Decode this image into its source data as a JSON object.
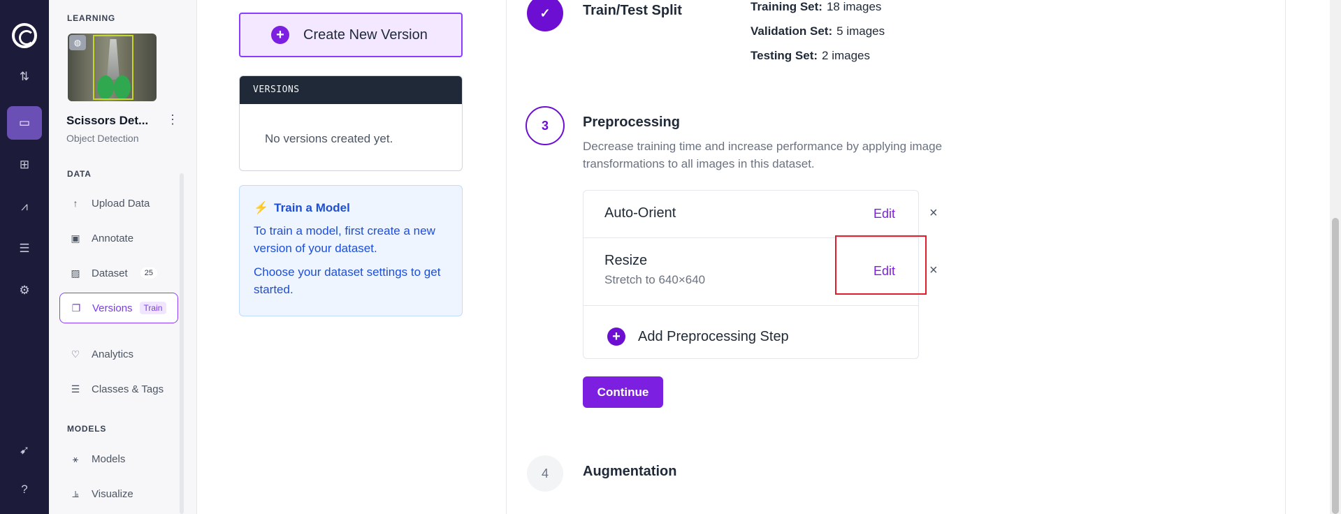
{
  "rail": {
    "icons": [
      "logo-icon",
      "upload-download-icon",
      "inbox-icon",
      "hierarchy-icon",
      "chart-icon",
      "server-icon",
      "settings-icon",
      "rocket-icon",
      "help-icon"
    ]
  },
  "sidebar": {
    "learning_label": "LEARNING",
    "project_name": "Scissors Det...",
    "project_menu": "⋮",
    "project_type": "Object Detection",
    "data_label": "DATA",
    "models_label": "MODELS",
    "items": [
      {
        "label": "Upload Data",
        "icon": "↑"
      },
      {
        "label": "Annotate",
        "icon": "▣"
      },
      {
        "label": "Dataset",
        "icon": "▨",
        "badge": "25"
      },
      {
        "label": "Versions",
        "icon": "❐",
        "badge": "Train"
      },
      {
        "label": "Analytics",
        "icon": "♡"
      },
      {
        "label": "Classes & Tags",
        "icon": "☰"
      },
      {
        "label": "Models",
        "icon": "⚹"
      },
      {
        "label": "Visualize",
        "icon": "⫡"
      }
    ]
  },
  "main": {
    "create_label": "Create New Version",
    "versions_header": "VERSIONS",
    "versions_empty": "No versions created yet.",
    "train_title": "Train a Model",
    "train_p1": "To train a model, first create a new version of your dataset.",
    "train_p2": "Choose your dataset settings to get started."
  },
  "steps": {
    "split": {
      "title": "Train/Test Split",
      "training_label": "Training Set:",
      "training_value": "18 images",
      "validation_label": "Validation Set:",
      "validation_value": "5 images",
      "testing_label": "Testing Set:",
      "testing_value": "2 images"
    },
    "preprocessing": {
      "number": "3",
      "title": "Preprocessing",
      "description": "Decrease training time and increase performance by applying image transformations to all images in this dataset.",
      "items": [
        {
          "name": "Auto-Orient",
          "sub": "",
          "edit": "Edit",
          "remove": "×"
        },
        {
          "name": "Resize",
          "sub": "Stretch to 640×640",
          "edit": "Edit",
          "remove": "×"
        }
      ],
      "add_label": "Add Preprocessing Step",
      "continue_label": "Continue"
    },
    "augmentation": {
      "number": "4",
      "title": "Augmentation"
    }
  },
  "colors": {
    "accent": "#7c1fe0",
    "rail_bg": "#1d1b3a",
    "highlight": "#e11d2a"
  }
}
